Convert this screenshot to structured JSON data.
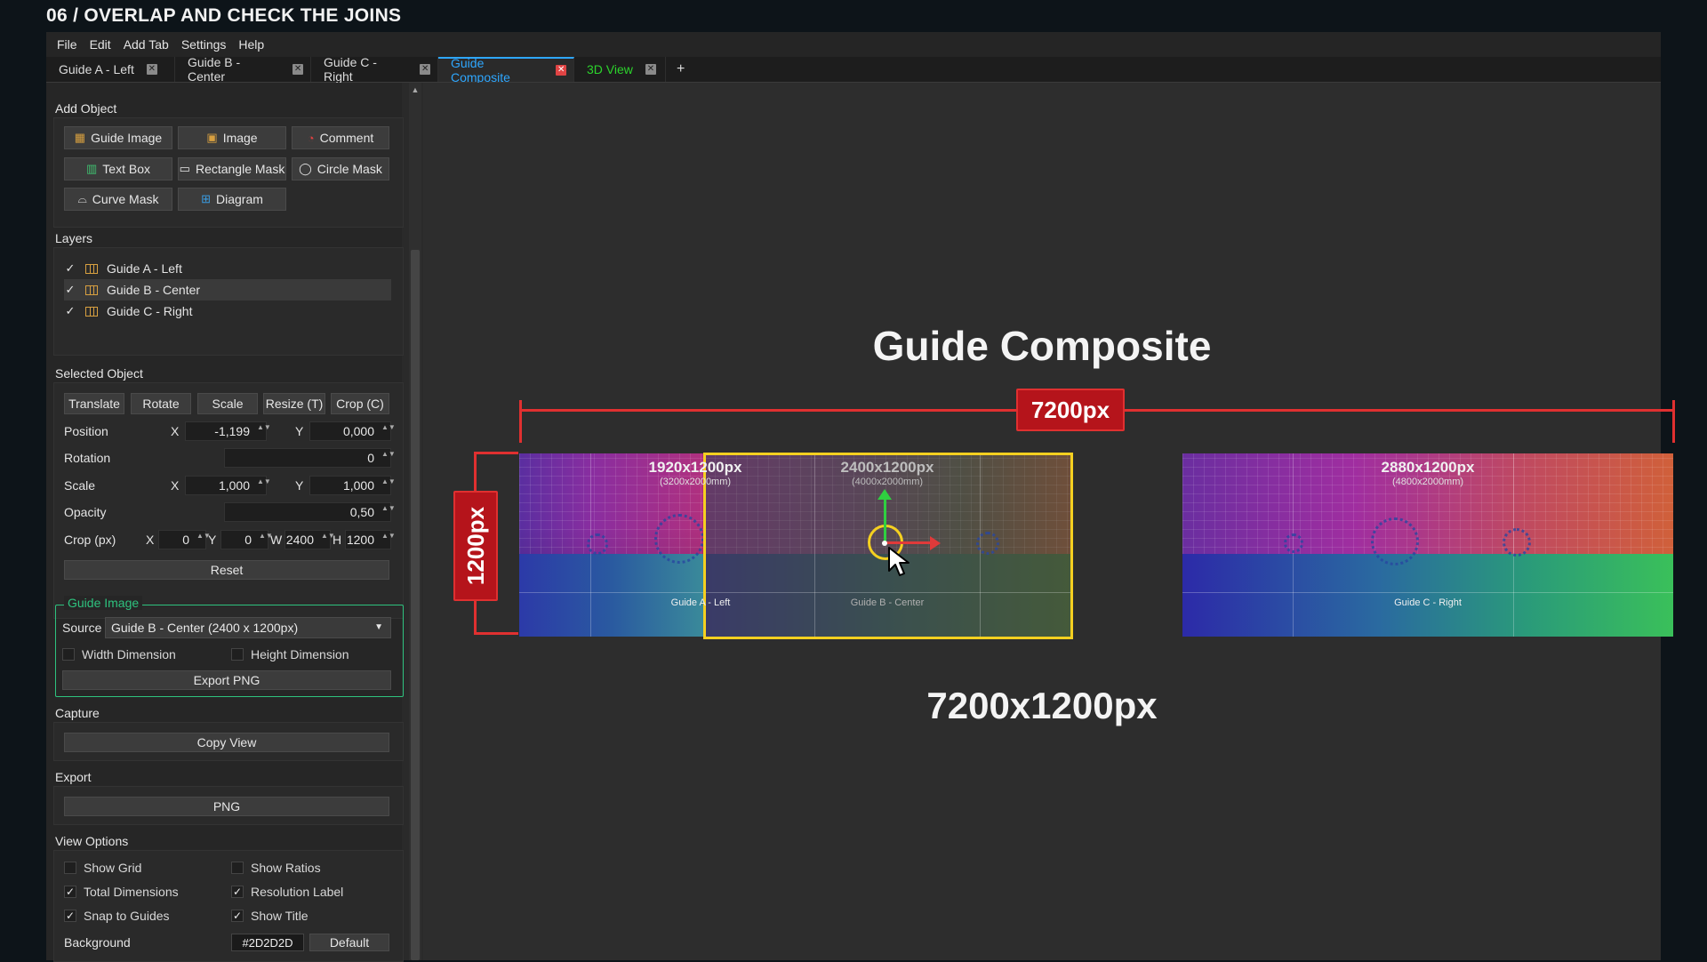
{
  "page_title": "06 / OVERLAP AND CHECK THE JOINS",
  "menu": [
    "File",
    "Edit",
    "Add Tab",
    "Settings",
    "Help"
  ],
  "tabs": [
    {
      "label": "Guide A - Left"
    },
    {
      "label": "Guide B - Center"
    },
    {
      "label": "Guide C - Right"
    },
    {
      "label": "Guide Composite"
    },
    {
      "label": "3D View"
    }
  ],
  "tab_add": "+",
  "add_object": {
    "title": "Add Object",
    "buttons": [
      "Guide Image",
      "Image",
      "Comment",
      "Text Box",
      "Rectangle Mask",
      "Circle Mask",
      "Curve Mask",
      "Diagram"
    ]
  },
  "layers": {
    "title": "Layers",
    "items": [
      {
        "label": "Guide A - Left",
        "checked": true
      },
      {
        "label": "Guide B - Center",
        "checked": true
      },
      {
        "label": "Guide C - Right",
        "checked": true
      }
    ]
  },
  "selected_object": {
    "title": "Selected Object",
    "modes": [
      "Translate",
      "Rotate",
      "Scale",
      "Resize (T)",
      "Crop (C)"
    ],
    "position_label": "Position",
    "x_label": "X",
    "y_label": "Y",
    "position_x": "-1,199",
    "position_y": "0,000",
    "rotation_label": "Rotation",
    "rotation": "0",
    "scale_label": "Scale",
    "scale_x": "1,000",
    "scale_y": "1,000",
    "opacity_label": "Opacity",
    "opacity": "0,50",
    "crop_label": "Crop (px)",
    "w_label": "W",
    "h_label": "H",
    "crop_x": "0",
    "crop_y": "0",
    "crop_w": "2400",
    "crop_h": "1200",
    "reset": "Reset"
  },
  "guide_image": {
    "title": "Guide Image",
    "source_label": "Source",
    "source_value": "Guide B - Center (2400 x 1200px)",
    "width_dimension": "Width Dimension",
    "height_dimension": "Height Dimension",
    "export_png": "Export PNG"
  },
  "capture": {
    "title": "Capture",
    "copy_view": "Copy View"
  },
  "export": {
    "title": "Export",
    "png": "PNG"
  },
  "view_options": {
    "title": "View Options",
    "options": [
      {
        "label": "Show Grid",
        "checked": false
      },
      {
        "label": "Show Ratios",
        "checked": false
      },
      {
        "label": "Total Dimensions",
        "checked": true
      },
      {
        "label": "Resolution Label",
        "checked": true
      },
      {
        "label": "Snap to Guides",
        "checked": true
      },
      {
        "label": "Show Title",
        "checked": true
      }
    ],
    "background_label": "Background",
    "background_value": "#2D2D2D",
    "default_button": "Default"
  },
  "canvas": {
    "title": "Guide Composite",
    "width_badge": "7200px",
    "height_badge": "1200px",
    "total_label": "7200x1200px",
    "tiles": [
      {
        "res": "1920x1200px",
        "mm": "(3200x2000mm)",
        "name": "Guide A - Left"
      },
      {
        "res": "2400x1200px",
        "mm": "(4000x2000mm)",
        "name": "Guide B - Center"
      },
      {
        "res": "2880x1200px",
        "mm": "(4800x2000mm)",
        "name": "Guide C - Right"
      }
    ]
  },
  "colors": {
    "accent_blue": "#2ea7ff",
    "accent_green": "#2ec27e",
    "dimension_red": "#e03030",
    "badge_red": "#b5141b",
    "selection_yellow": "#f5d020",
    "background": "#2D2D2D"
  }
}
